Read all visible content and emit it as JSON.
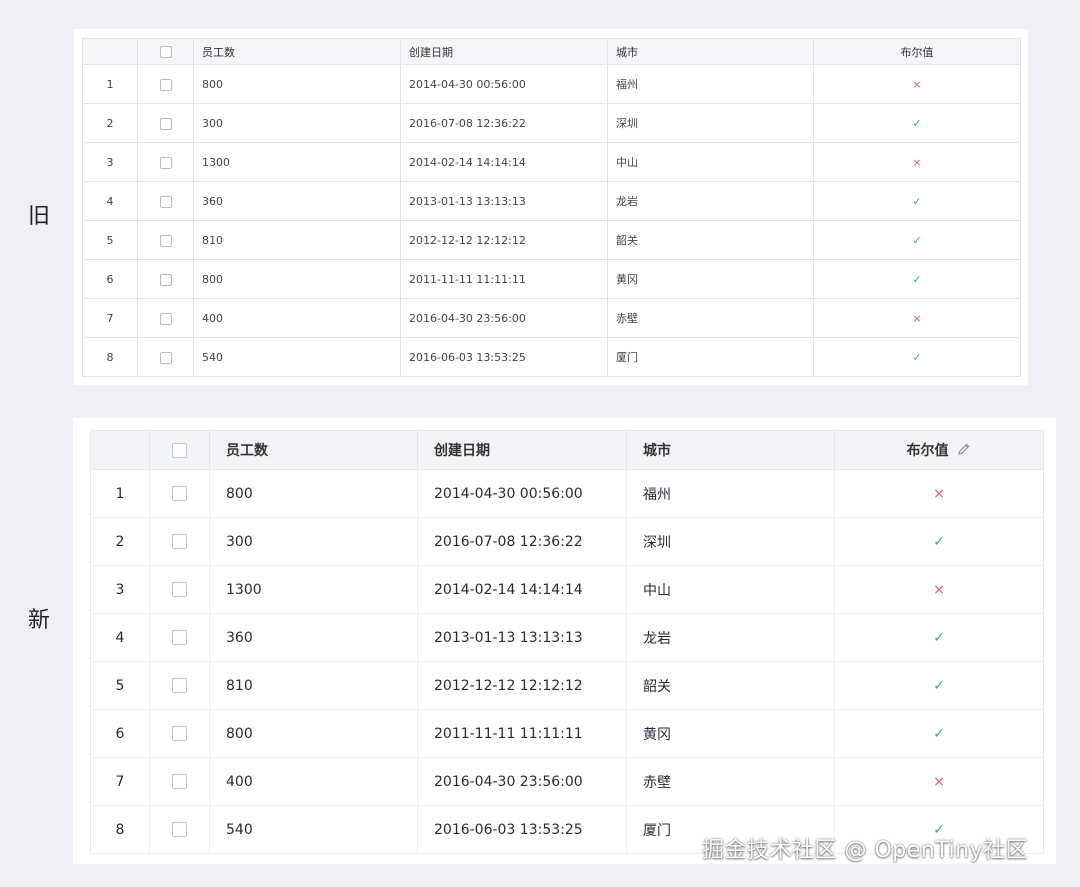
{
  "labels": {
    "old": "旧",
    "new": "新"
  },
  "headers": {
    "employees": "员工数",
    "created_date": "创建日期",
    "city": "城市",
    "boolean": "布尔值"
  },
  "rows": [
    {
      "index": "1",
      "employees": "800",
      "created_date": "2014-04-30 00:56:00",
      "city": "福州",
      "boolean": false
    },
    {
      "index": "2",
      "employees": "300",
      "created_date": "2016-07-08 12:36:22",
      "city": "深圳",
      "boolean": true
    },
    {
      "index": "3",
      "employees": "1300",
      "created_date": "2014-02-14 14:14:14",
      "city": "中山",
      "boolean": false
    },
    {
      "index": "4",
      "employees": "360",
      "created_date": "2013-01-13 13:13:13",
      "city": "龙岩",
      "boolean": true
    },
    {
      "index": "5",
      "employees": "810",
      "created_date": "2012-12-12 12:12:12",
      "city": "韶关",
      "boolean": true
    },
    {
      "index": "6",
      "employees": "800",
      "created_date": "2011-11-11 11:11:11",
      "city": "黄冈",
      "boolean": true
    },
    {
      "index": "7",
      "employees": "400",
      "created_date": "2016-04-30 23:56:00",
      "city": "赤壁",
      "boolean": false
    },
    {
      "index": "8",
      "employees": "540",
      "created_date": "2016-06-03 13:53:25",
      "city": "厦门",
      "boolean": true
    }
  ],
  "icons": {
    "true": "check-icon",
    "false": "cross-icon",
    "edit": "edit-pencil-icon"
  },
  "colors": {
    "true": "#3cb371",
    "false": "#e05563"
  },
  "watermark": "掘金技术社区 @ OpenTiny社区"
}
